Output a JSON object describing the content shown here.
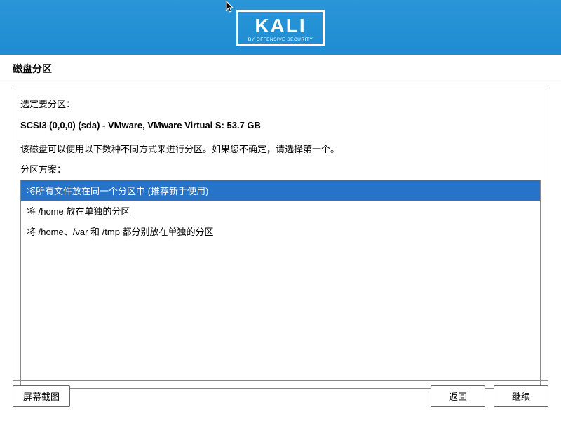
{
  "logo": {
    "name": "KALI",
    "tagline": "BY OFFENSIVE SECURITY"
  },
  "page_title": "磁盘分区",
  "prompt": "选定要分区：",
  "disk": "SCSI3 (0,0,0) (sda) - VMware, VMware Virtual S: 53.7 GB",
  "instruction": "该磁盘可以使用以下数种不同方式来进行分区。如果您不确定，请选择第一个。",
  "scheme_label": "分区方案：",
  "options": [
    "将所有文件放在同一个分区中 (推荐新手使用)",
    "将 /home 放在单独的分区",
    "将 /home、/var 和 /tmp 都分别放在单独的分区"
  ],
  "selected_index": 0,
  "buttons": {
    "screenshot": "屏幕截图",
    "back": "返回",
    "continue": "继续"
  }
}
